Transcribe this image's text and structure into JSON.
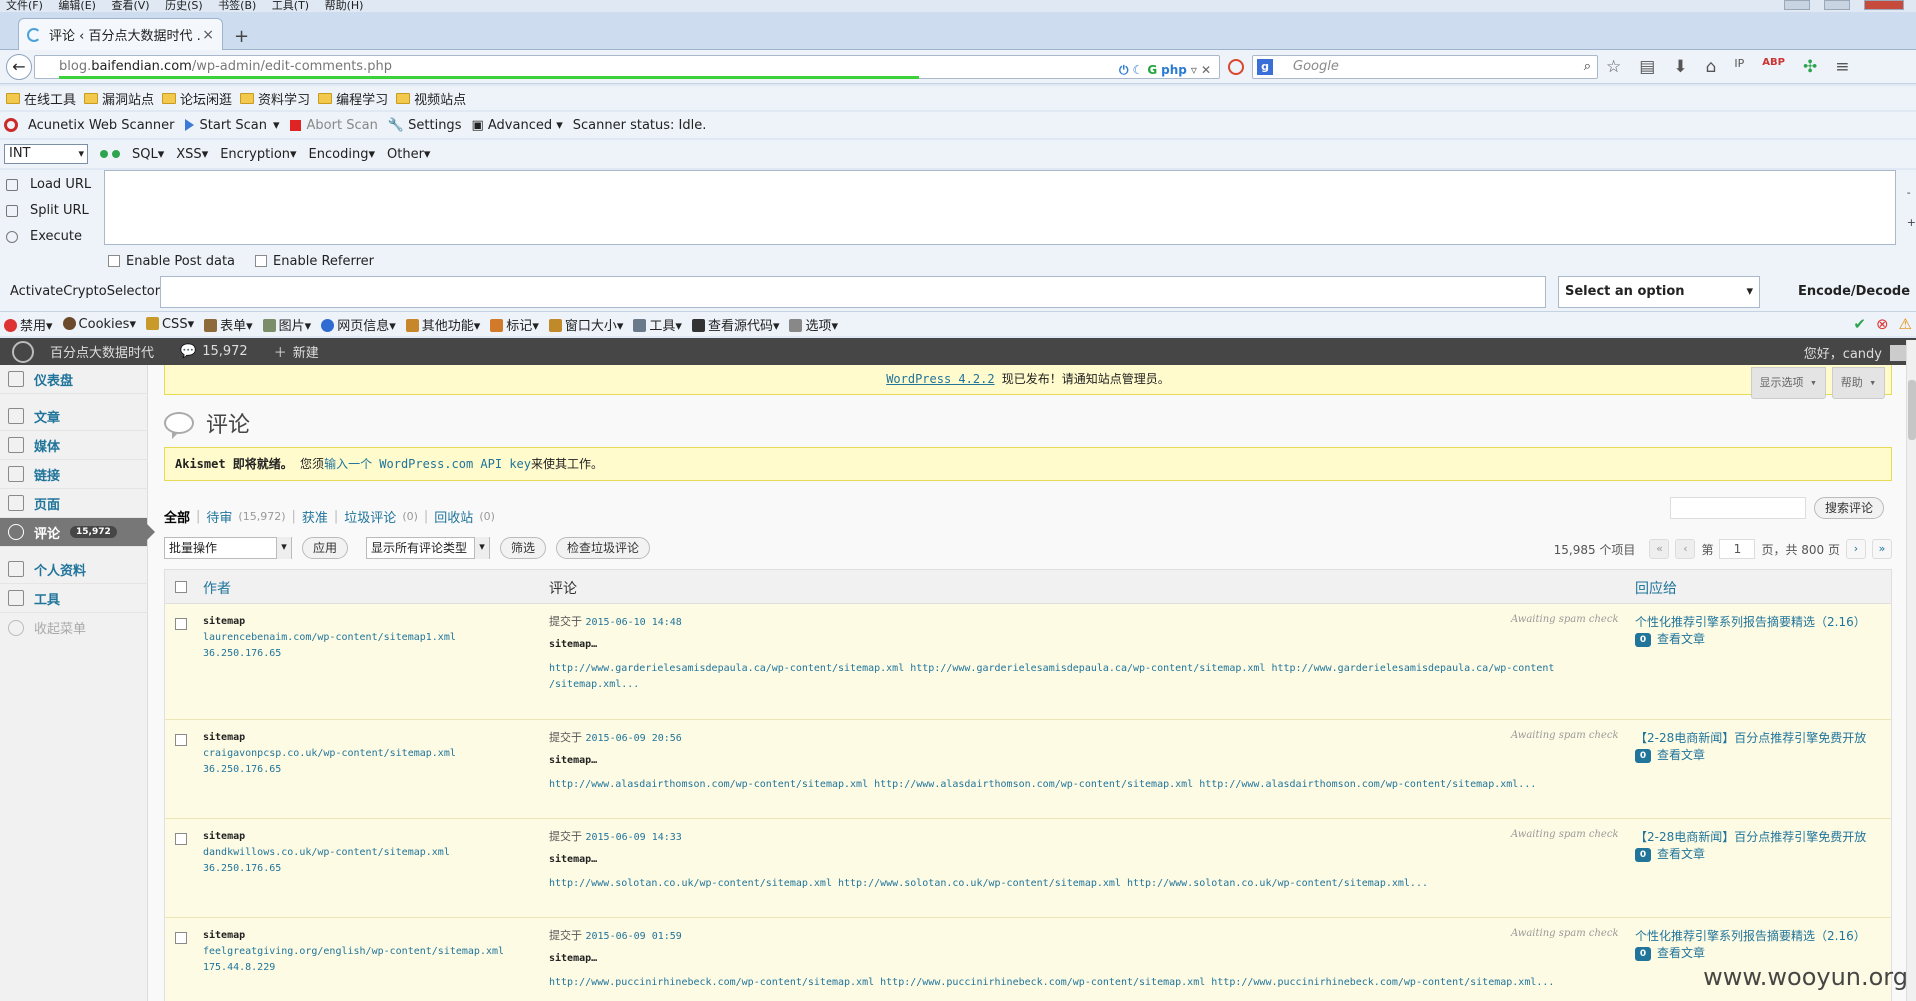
{
  "menubar": [
    "文件(F)",
    "编辑(E)",
    "查看(V)",
    "历史(S)",
    "书签(B)",
    "工具(T)",
    "帮助(H)"
  ],
  "tab": {
    "title": "评论 ‹ 百分点大数据时代 ...",
    "close": "×",
    "new": "+"
  },
  "url": {
    "prefix": "blog.",
    "host": "baifendian.com",
    "path": "/wp-admin/edit-comments.php"
  },
  "url_icons": [
    "⏻",
    "☾",
    "G",
    "php",
    "▿",
    "✕"
  ],
  "search": {
    "engine": "g",
    "placeholder": "Google",
    "icon": "⌕"
  },
  "toolbar_icons": [
    "☆",
    "▤",
    "⬇",
    "⌂",
    "IP",
    "ABP",
    "✣",
    "≡"
  ],
  "bookmarks": [
    "在线工具",
    "漏洞站点",
    "论坛闲逛",
    "资料学习",
    "编程学习",
    "视频站点"
  ],
  "acunetix": {
    "name": "Acunetix Web Scanner",
    "start": "Start Scan",
    "abort": "Abort Scan",
    "settings": "Settings",
    "advanced": "Advanced",
    "status": "Scanner status: Idle."
  },
  "hackbar": {
    "select": "INT",
    "menus": [
      "SQL",
      "XSS",
      "Encryption",
      "Encoding",
      "Other"
    ],
    "actions": [
      "Load URL",
      "Split URL",
      "Execute"
    ],
    "side": [
      "-",
      "+"
    ],
    "checks": [
      "Enable Post data",
      "Enable Referrer"
    ]
  },
  "crypto": {
    "label": "ActivateCryptoSelector",
    "select": "Select an option",
    "button": "Encode/Decode"
  },
  "webdev": [
    "禁用",
    "Cookies",
    "CSS",
    "表单",
    "图片",
    "网页信息",
    "其他功能",
    "标记",
    "窗口大小",
    "工具",
    "查看源代码",
    "选项"
  ],
  "wp": {
    "site": "百分点大数据时代",
    "comments_count": "15,972",
    "new": "新建",
    "howdy": "您好，candy",
    "menu": {
      "dashboard": "仪表盘",
      "posts": "文章",
      "media": "媒体",
      "links": "链接",
      "pages": "页面",
      "comments": "评论",
      "comments_badge": "15,972",
      "profile": "个人资料",
      "tools": "工具",
      "collapse": "收起菜单"
    },
    "nag": {
      "link": "WordPress 4.2.2",
      "text": "现已发布！请通知站点管理员。"
    },
    "screen_options": "显示选项 ▾",
    "help": "帮助 ▾",
    "page_title": "评论",
    "akismet": {
      "bold": "Akismet 即将就绪。",
      "pre": "您须",
      "link": "输入一个 WordPress.com API key",
      "post": "来使其工作。"
    },
    "filters": [
      {
        "label": "全部",
        "count": ""
      },
      {
        "label": "待审",
        "count": "(15,972)"
      },
      {
        "label": "获准",
        "count": ""
      },
      {
        "label": "垃圾评论",
        "count": "(0)"
      },
      {
        "label": "回收站",
        "count": "(0)"
      }
    ],
    "search_button": "搜索评论",
    "bulk": "批量操作",
    "apply": "应用",
    "type_filter": "显示所有评论类型",
    "filter_btn": "筛选",
    "check_spam": "检查垃圾评论",
    "items": "15,985 个项目",
    "page_label": "第",
    "page_num": "1",
    "page_total": "页，共 800 页",
    "pager": [
      "«",
      "‹",
      "›",
      "»"
    ],
    "columns": {
      "author": "作者",
      "comment": "评论",
      "response": "回应给"
    },
    "submitted": "提交于",
    "spam_check": "Awaiting spam check",
    "view_post": "查看文章",
    "count_badge": "0",
    "rows": [
      {
        "name": "sitemap",
        "url": "laurencebenaim.com/wp-content/sitemap1.xml",
        "ip": "36.250.176.65",
        "date": "2015-06-10 14:48",
        "title": "sitemap…",
        "body": "http://www.garderielesamisdepaula.ca/wp-content/sitemap.xml http://www.garderielesamisdepaula.ca/wp-content/sitemap.xml http://www.garderielesamisdepaula.ca/wp-content /sitemap.xml...",
        "post": "个性化推荐引擎系列报告摘要精选（2.16）"
      },
      {
        "name": "sitemap",
        "url": "craigavonpcsp.co.uk/wp-content/sitemap.xml",
        "ip": "36.250.176.65",
        "date": "2015-06-09 20:56",
        "title": "sitemap…",
        "body": "http://www.alasdairthomson.com/wp-content/sitemap.xml http://www.alasdairthomson.com/wp-content/sitemap.xml http://www.alasdairthomson.com/wp-content/sitemap.xml...",
        "post": "【2-28电商新闻】百分点推荐引擎免费开放"
      },
      {
        "name": "sitemap",
        "url": "dandkwillows.co.uk/wp-content/sitemap.xml",
        "ip": "36.250.176.65",
        "date": "2015-06-09 14:33",
        "title": "sitemap…",
        "body": "http://www.solotan.co.uk/wp-content/sitemap.xml http://www.solotan.co.uk/wp-content/sitemap.xml http://www.solotan.co.uk/wp-content/sitemap.xml...",
        "post": "【2-28电商新闻】百分点推荐引擎免费开放"
      },
      {
        "name": "sitemap",
        "url": "feelgreatgiving.org/english/wp-content/sitemap.xml",
        "ip": "175.44.8.229",
        "date": "2015-06-09 01:59",
        "title": "sitemap…",
        "body": "http://www.puccinirhinebeck.com/wp-content/sitemap.xml http://www.puccinirhinebeck.com/wp-content/sitemap.xml http://www.puccinirhinebeck.com/wp-content/sitemap.xml...",
        "post": "个性化推荐引擎系列报告摘要精选（2.16）"
      }
    ]
  },
  "watermark": "www.wooyun.org"
}
